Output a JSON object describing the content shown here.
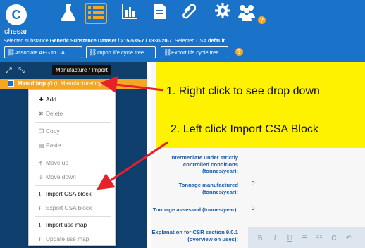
{
  "header": {
    "app_name": "chesar",
    "logo_letter": "C",
    "substance_prefix": "Selected substance:",
    "substance_value": "Generic Substance Dataset / 215-535-7 / 1330-20-7",
    "csa_prefix": "Selected CSA",
    "csa_value": "default",
    "nav_icons": [
      "flask-icon",
      "list-icon",
      "bar-chart-icon",
      "document-icon",
      "paperclip-icon",
      "gear-icon",
      "users-icon",
      "help-icon"
    ],
    "help_glyph": "?"
  },
  "toolbar": {
    "buttons": [
      {
        "label": "Associate AEG to CA",
        "icon": "link-icon"
      },
      {
        "label": "Import life cycle tree",
        "icon": "link-icon"
      },
      {
        "label": "Export life cycle tree",
        "icon": "link-icon"
      }
    ]
  },
  "tree": {
    "tooltip": "Manufacture / Import",
    "selected_node": {
      "label_bold": "Manuf.Imp",
      "label_tonnage": "(0 t)",
      "label_rest": ": Manufacture/import"
    }
  },
  "context_menu": {
    "items": [
      {
        "label": "Add",
        "icon": "plus-icon",
        "glyph": "✚",
        "enabled": true
      },
      {
        "label": "Delete",
        "icon": "x-icon",
        "glyph": "✖",
        "enabled": false
      },
      {
        "label": "Copy",
        "icon": "copy-icon",
        "glyph": "❐",
        "enabled": false
      },
      {
        "label": "Paste",
        "icon": "paste-icon",
        "glyph": "▤",
        "enabled": false
      },
      {
        "label": "Move up",
        "icon": "arrow-up-icon",
        "glyph": "🡩",
        "enabled": false
      },
      {
        "label": "Move down",
        "icon": "arrow-down-icon",
        "glyph": "🡫",
        "enabled": false
      },
      {
        "label": "Import CSA block",
        "icon": "import-icon",
        "glyph": "⭳",
        "enabled": true
      },
      {
        "label": "Export CSA block",
        "icon": "export-icon",
        "glyph": "⭱",
        "enabled": false
      },
      {
        "label": "Import use map",
        "icon": "import-icon",
        "glyph": "⭳",
        "enabled": true
      },
      {
        "label": "Update use map",
        "icon": "update-icon",
        "glyph": "⭱",
        "enabled": false
      }
    ]
  },
  "form": {
    "fields": [
      {
        "label": "Intermediate under strictly controlled conditions (tonnes/year):",
        "value": ""
      },
      {
        "label": "Tonnage manufactured (tonnes/year):",
        "value": "0"
      },
      {
        "label": "Tonnage assessed (tonnes/year):",
        "value": "0"
      },
      {
        "label": "Explanation for CSR section 9.0.1 (overview on uses):",
        "value": ""
      }
    ]
  },
  "editor_toolbar": {
    "buttons": [
      {
        "glyph": "B",
        "icon": "bold-icon"
      },
      {
        "glyph": "I",
        "icon": "italic-icon"
      },
      {
        "glyph": "U",
        "icon": "underline-icon"
      },
      {
        "glyph": "☰",
        "icon": "bullet-list-icon"
      },
      {
        "glyph": "☷",
        "icon": "numbered-list-icon"
      },
      {
        "glyph": "C",
        "icon": "clear-format-icon"
      },
      {
        "glyph": "↶",
        "icon": "undo-icon"
      }
    ]
  },
  "annotations": {
    "step1": "1. Right click to see drop down",
    "step2": "2. Left click Import CSA Block",
    "arrow_color": "#e8202a"
  },
  "colors": {
    "header_blue": "#1a73c8",
    "tree_panel": "#0e3f6d",
    "selection_orange": "#f5a623",
    "callout_yellow": "#fff200"
  }
}
